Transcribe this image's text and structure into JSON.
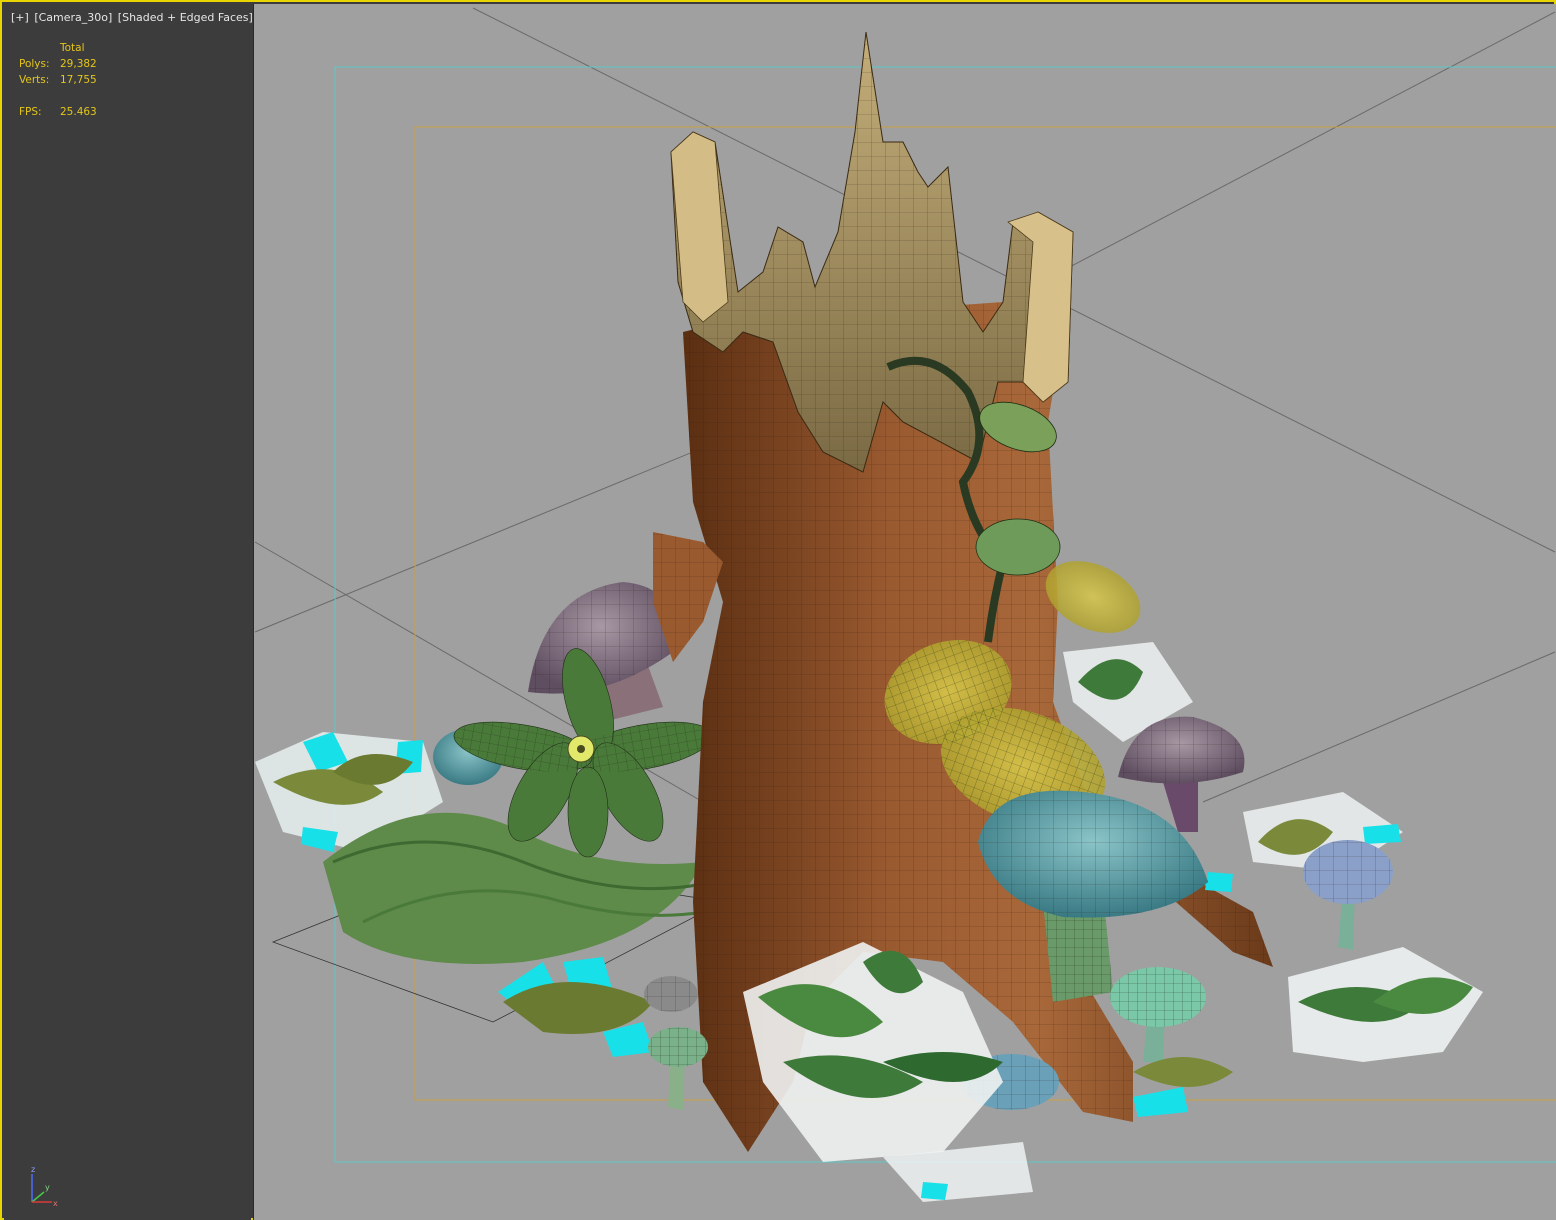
{
  "viewport": {
    "label_plus": "[+]",
    "label_camera": "[Camera_30o]",
    "label_mode": "[Shaded + Edged Faces]"
  },
  "stats": {
    "header": "Total",
    "polys_label": "Polys:",
    "polys_value": "29,382",
    "verts_label": "Verts:",
    "verts_value": "17,755",
    "fps_label": "FPS:",
    "fps_value": "25.463"
  },
  "axis_gizmo": {
    "z": "z",
    "y": "y",
    "x": "x"
  },
  "colors": {
    "viewport_border": "#e8d400",
    "stats_text": "#e4c61a",
    "scene_bg": "#a0a0a0",
    "safe_frame": "#5ec8c8",
    "action_frame": "#c8a040"
  }
}
